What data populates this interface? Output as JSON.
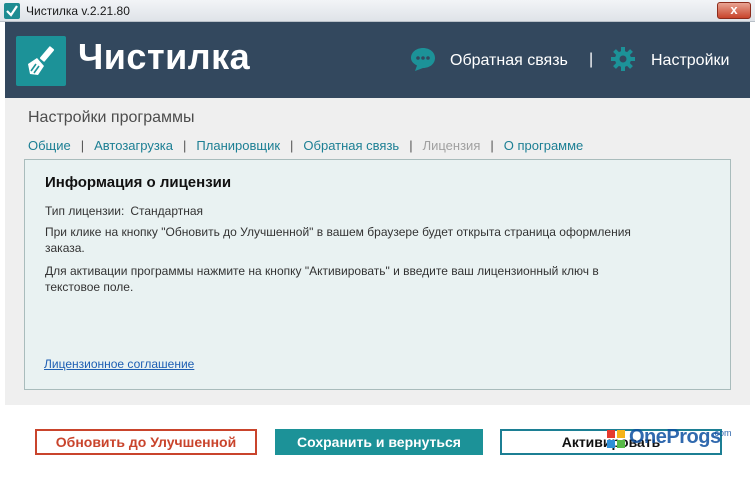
{
  "window": {
    "title": "Чистилка v.2.21.80",
    "close_glyph": "x"
  },
  "header": {
    "app_name": "Чистилка",
    "feedback_label": "Обратная связь",
    "separator": "|",
    "settings_label": "Настройки",
    "icons": [
      "broom-logo-icon",
      "chat-bubble-icon",
      "gear-icon"
    ]
  },
  "settings": {
    "title": "Настройки программы",
    "tabs": [
      {
        "label": "Общие",
        "active": false
      },
      {
        "label": "Автозагрузка",
        "active": false
      },
      {
        "label": "Планировщик",
        "active": false
      },
      {
        "label": "Обратная связь",
        "active": false
      },
      {
        "label": "Лицензия",
        "active": true
      },
      {
        "label": "О программе",
        "active": false
      }
    ],
    "tab_separator": "|"
  },
  "license": {
    "heading": "Информация о лицензии",
    "type_label": "Тип лицензии:",
    "type_value": "Стандартная",
    "paragraph1": "При клике на кнопку \"Обновить до Улучшенной\" в вашем браузере будет открыта страница оформления заказа.",
    "paragraph2": "Для активации программы нажмите на кнопку \"Активировать\" и введите ваш лицензионный ключ в текстовое поле.",
    "agreement_link": "Лицензионное соглашение"
  },
  "footer": {
    "upgrade_button": "Обновить до Улучшенной",
    "save_button": "Сохранить и вернуться",
    "activate_button": "Активировать"
  },
  "watermark": {
    "text": "OneProgs",
    "suffix": ".com"
  },
  "colors": {
    "header_bg": "#33485e",
    "accent_teal": "#1c9298",
    "link_teal": "#1c7f94",
    "upgrade_red": "#c9442c",
    "panel_bg": "#e9f2f2"
  }
}
